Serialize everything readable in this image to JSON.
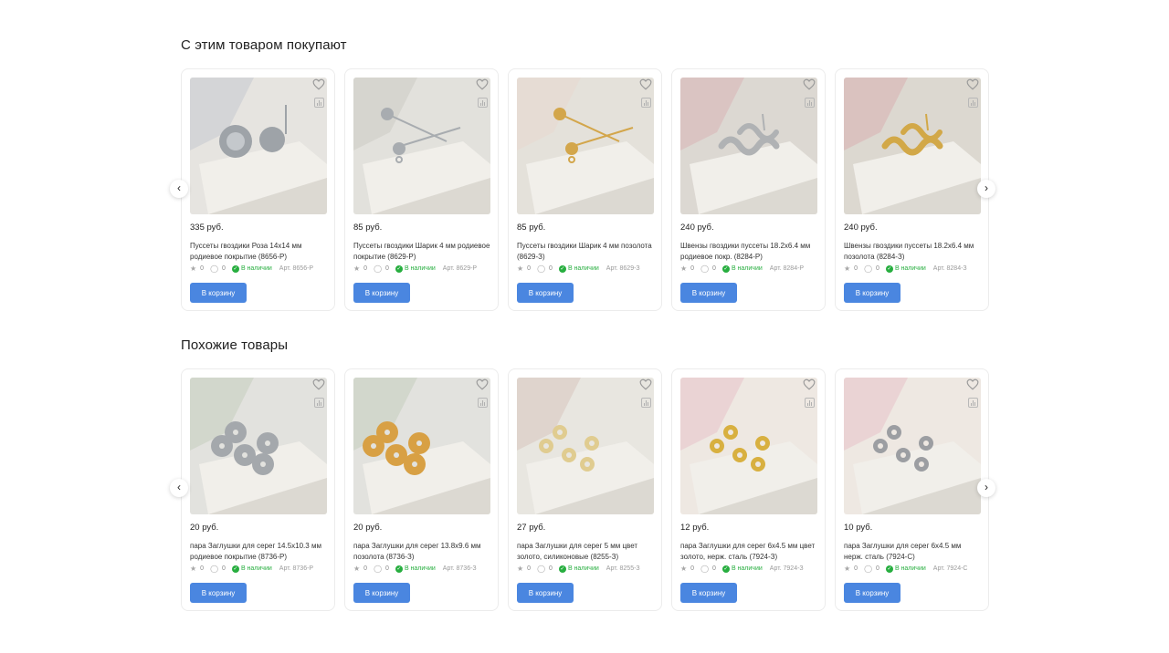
{
  "sections": [
    {
      "title": "С этим товаром покупают",
      "prev_arrow": "‹",
      "next_arrow": "›",
      "products": [
        {
          "price": "335 руб.",
          "name": "Пуссеты гвоздики Роза 14х14 мм родиевое покрытие (8656-Р)",
          "rating": "0",
          "reviews": "0",
          "stock": "В наличии",
          "article": "Арт. 8656-Р",
          "button": "В корзину",
          "image": "silver-rose-stud-earrings",
          "palette": {
            "bg": "#e6e4e0",
            "accent": "#c8ccd0",
            "metal": "#9ea3a8"
          }
        },
        {
          "price": "85 руб.",
          "name": "Пуссеты гвоздики Шарик 4 мм родиевое покрытие (8629-Р)",
          "rating": "0",
          "reviews": "0",
          "stock": "В наличии",
          "article": "Арт. 8629-Р",
          "button": "В корзину",
          "image": "silver-ball-stud-earrings",
          "palette": {
            "bg": "#e2e1dc",
            "accent": "#cfcdc6",
            "metal": "#a8acb0"
          }
        },
        {
          "price": "85 руб.",
          "name": "Пуссеты гвоздики Шарик 4 мм позолота (8629-З)",
          "rating": "0",
          "reviews": "0",
          "stock": "В наличии",
          "article": "Арт. 8629-З",
          "button": "В корзину",
          "image": "gold-ball-stud-earrings",
          "palette": {
            "bg": "#e4e1da",
            "accent": "#e8d8d0",
            "metal": "#d3a64b"
          }
        },
        {
          "price": "240 руб.",
          "name": "Швензы гвоздики пуссеты 18.2х6.4 мм родиевое покр. (8284-Р)",
          "rating": "0",
          "reviews": "0",
          "stock": "В наличии",
          "article": "Арт. 8284-Р",
          "button": "В корзину",
          "image": "silver-wave-stud-earrings",
          "palette": {
            "bg": "#dcd8d2",
            "accent": "#d8b8b8",
            "metal": "#b0b2b4"
          }
        },
        {
          "price": "240 руб.",
          "name": "Швензы гвоздики пуссеты 18.2х6.4 мм позолота (8284-З)",
          "rating": "0",
          "reviews": "0",
          "stock": "В наличии",
          "article": "Арт. 8284-З",
          "button": "В корзину",
          "image": "gold-wave-stud-earrings",
          "palette": {
            "bg": "#dcd8d0",
            "accent": "#d8b4b4",
            "metal": "#d2a848"
          }
        }
      ]
    },
    {
      "title": "Похожие товары",
      "prev_arrow": "‹",
      "next_arrow": "›",
      "products": [
        {
          "price": "20 руб.",
          "name": "пара Заглушки для серег 14.5х10.3 мм родиевое покрытие (8736-Р)",
          "rating": "0",
          "reviews": "0",
          "stock": "В наличии",
          "article": "Арт. 8736-Р",
          "button": "В корзину",
          "image": "silver-heart-earring-backs",
          "palette": {
            "bg": "#e2e2de",
            "accent": "#c8d0c0",
            "metal": "#a4a8ac"
          }
        },
        {
          "price": "20 руб.",
          "name": "пара Заглушки для серег 13.8х9.6 мм позолота (8736-З)",
          "rating": "0",
          "reviews": "0",
          "stock": "В наличии",
          "article": "Арт. 8736-З",
          "button": "В корзину",
          "image": "gold-heart-earring-backs",
          "palette": {
            "bg": "#e2e2de",
            "accent": "#c8d0c0",
            "metal": "#d8a044"
          }
        },
        {
          "price": "27 руб.",
          "name": "пара Заглушки для серег 5 мм цвет золото, силиконовые (8255-З)",
          "rating": "0",
          "reviews": "0",
          "stock": "В наличии",
          "article": "Арт. 8255-З",
          "button": "В корзину",
          "image": "gold-silicone-earring-backs",
          "palette": {
            "bg": "#e8e6e0",
            "accent": "#d8c8c0",
            "metal": "#e0cc90"
          }
        },
        {
          "price": "12 руб.",
          "name": "пара Заглушки для серег 6х4.5 мм цвет золото, нерж. сталь (7924-З)",
          "rating": "0",
          "reviews": "0",
          "stock": "В наличии",
          "article": "Арт. 7924-З",
          "button": "В корзину",
          "image": "gold-butterfly-earring-backs",
          "palette": {
            "bg": "#eee8e2",
            "accent": "#e8c4cc",
            "metal": "#d8b040"
          }
        },
        {
          "price": "10 руб.",
          "name": "пара Заглушки для серег 6х4.5 мм нерж. сталь (7924-С)",
          "rating": "0",
          "reviews": "0",
          "stock": "В наличии",
          "article": "Арт. 7924-С",
          "button": "В корзину",
          "image": "silver-butterfly-earring-backs",
          "palette": {
            "bg": "#eee8e2",
            "accent": "#e8c4cc",
            "metal": "#9c9ea2"
          }
        }
      ]
    }
  ],
  "icons": {
    "favorite": "heart-icon",
    "compare": "compare-chart-icon",
    "rating": "star-icon",
    "reviews": "comment-icon",
    "stock": "check-circle-icon"
  },
  "colors": {
    "button": "#4a86e0",
    "in_stock": "#27ae3f"
  }
}
